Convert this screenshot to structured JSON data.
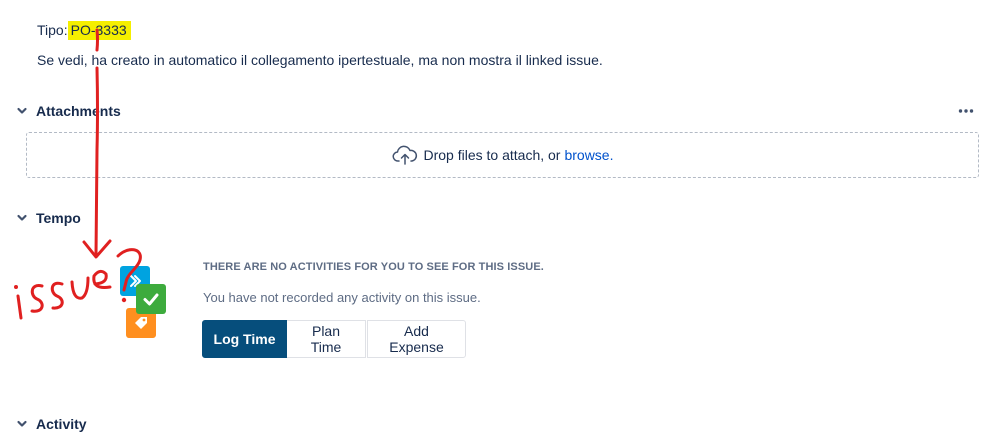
{
  "description": {
    "tipo_label": "Tipo:",
    "tipo_value": "PO-3333",
    "explanation": "Se vedi, ha creato in automatico il collegamento ipertestuale, ma non mostra il linked issue."
  },
  "attachments": {
    "title": "Attachments",
    "more_icon": "more-horizontal-icon",
    "dropzone_text": "Drop files to attach, or",
    "browse_label": "browse."
  },
  "tempo": {
    "title": "Tempo",
    "empty_heading": "THERE ARE NO ACTIVITIES FOR YOU TO SEE FOR THIS ISSUE.",
    "empty_sub": "You have not recorded any activity on this issue.",
    "buttons": {
      "log_time": "Log Time",
      "plan_time": "Plan Time",
      "add_expense": "Add Expense"
    }
  },
  "activity": {
    "title": "Activity"
  },
  "annotation": {
    "handwritten": "issue?",
    "color": "#e02020"
  },
  "colors": {
    "highlight": "#f5ef00",
    "primary_button": "#064e7c",
    "link": "#0052cc",
    "heading": "#172b4d",
    "muted": "#5e6c84"
  }
}
